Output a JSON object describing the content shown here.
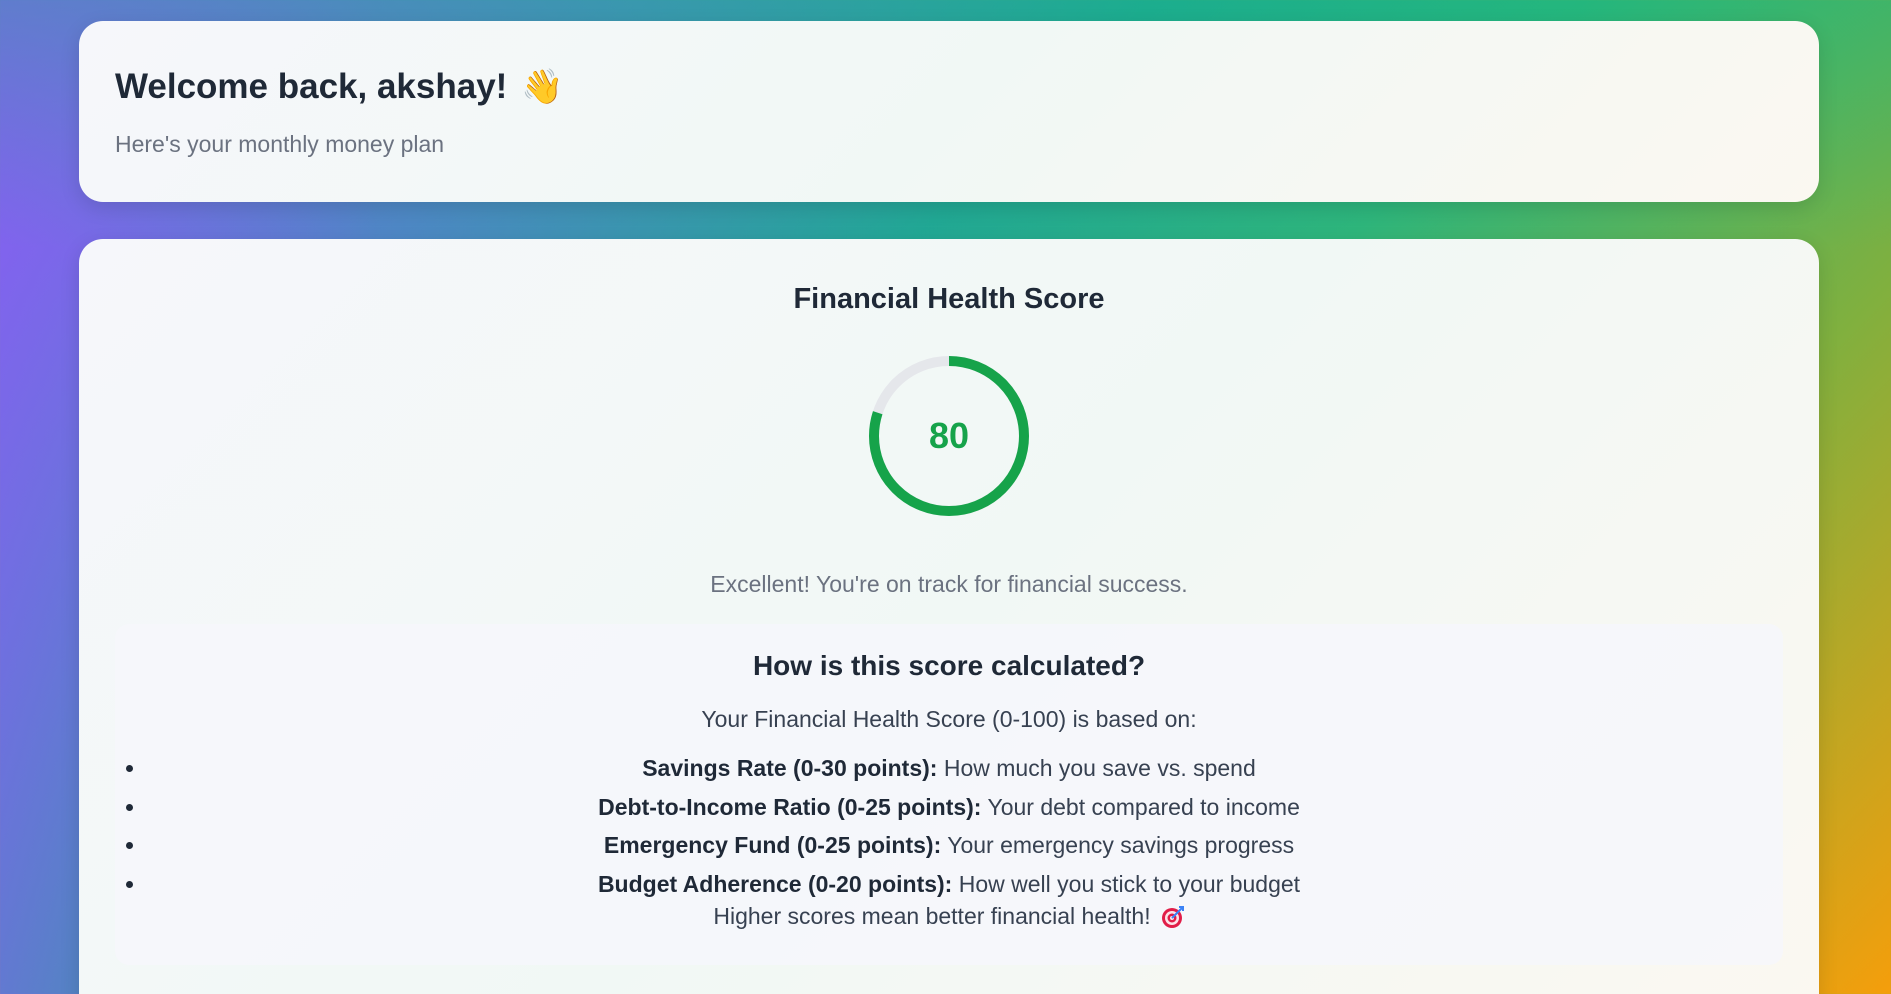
{
  "header": {
    "welcome_title": "Welcome back, akshay!",
    "wave_icon": "waving-hand-icon",
    "subtitle": "Here's your monthly money plan"
  },
  "score": {
    "title": "Financial Health Score",
    "value": "80",
    "max": 100,
    "progress": 0.8,
    "ring_color": "#16a34a",
    "track_color": "#e5e7eb",
    "message": "Excellent! You're on track for financial success."
  },
  "calculation": {
    "title": "How is this score calculated?",
    "intro": "Your Financial Health Score (0-100) is based on:",
    "items": [
      {
        "label": "Savings Rate (0-30 points):",
        "desc": " How much you save vs. spend"
      },
      {
        "label": "Debt-to-Income Ratio (0-25 points):",
        "desc": " Your debt compared to income"
      },
      {
        "label": "Emergency Fund (0-25 points):",
        "desc": " Your emergency savings progress"
      },
      {
        "label": "Budget Adherence (0-20 points):",
        "desc": " How well you stick to your budget"
      }
    ],
    "footer": "Higher scores mean better financial health!",
    "footer_icon": "target-icon"
  }
}
